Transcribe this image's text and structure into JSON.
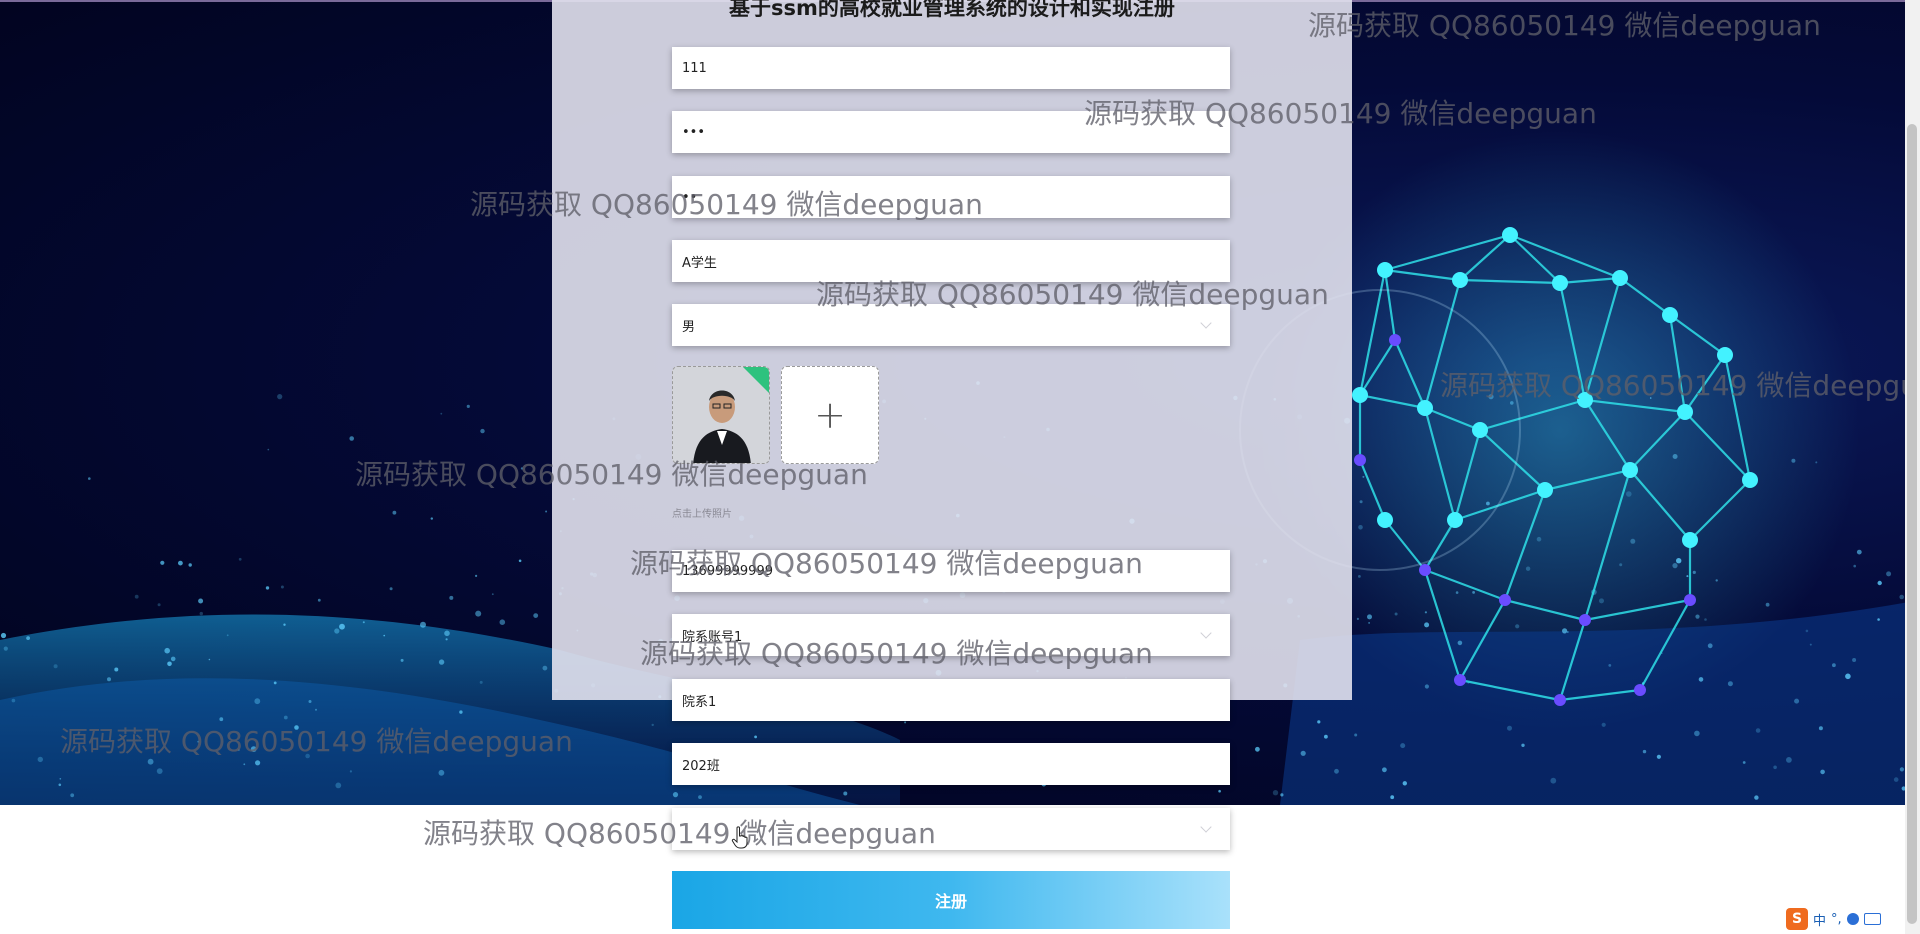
{
  "page": {
    "title": "基于ssm的高校就业管理系统的设计和实现注册"
  },
  "form": {
    "fields": [
      {
        "value": "111",
        "has_dropdown": false
      },
      {
        "value": "•••",
        "has_dropdown": false
      },
      {
        "value": "••",
        "has_dropdown": false
      },
      {
        "value": "A学生",
        "has_dropdown": false
      },
      {
        "value": "男",
        "has_dropdown": true
      },
      {
        "value": "13699999999",
        "has_dropdown": false
      },
      {
        "value": "院系账号1",
        "has_dropdown": true
      },
      {
        "value": "院系1",
        "has_dropdown": false
      },
      {
        "value": "202班",
        "has_dropdown": false
      },
      {
        "value": "",
        "has_dropdown": true
      }
    ],
    "upload_add_symbol": "+",
    "upload_hint": "点击上传照片",
    "register_label": "注册"
  },
  "watermark": {
    "text": "源码获取 QQ86050149 微信deepguan"
  },
  "ime": {
    "logo": "S",
    "lang": "中",
    "punct": "°,"
  },
  "icons": [
    "plus-icon",
    "chevron-down-icon",
    "cursor-hand-icon",
    "ime-logo-icon",
    "keyboard-icon",
    "emoji-icon"
  ],
  "colors": {
    "accent_start": "#1aa6e6",
    "accent_end": "#a9e1fb",
    "background_dark": "#040a38",
    "network_cyan": "#2fe0e8"
  }
}
